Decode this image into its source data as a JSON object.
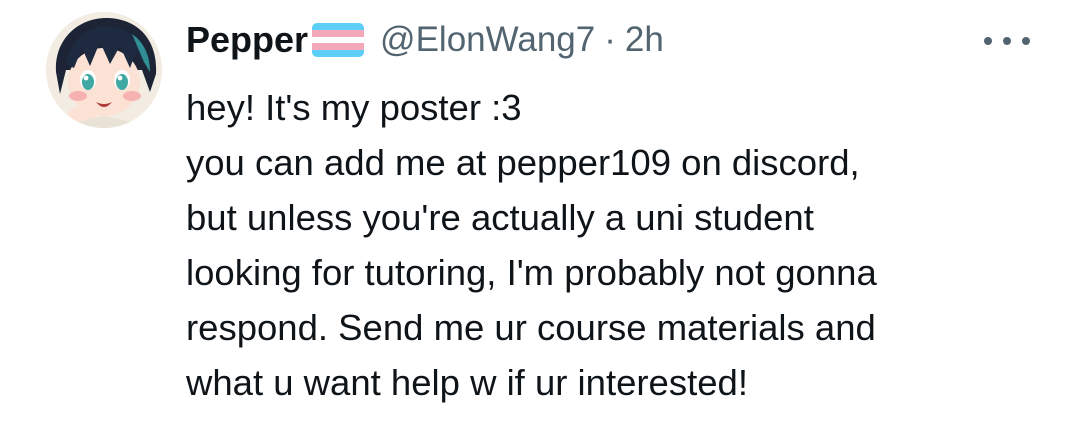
{
  "tweet": {
    "display_name": "Pepper",
    "handle": "@ElonWang7",
    "separator": "·",
    "timestamp": "2h",
    "flag_icon": "transgender-flag-icon",
    "flag_colors": [
      "#5bcefa",
      "#f5a9b8",
      "#ffffff",
      "#f5a9b8",
      "#5bcefa"
    ],
    "more_icon": "more-options-icon",
    "avatar_icon": "user-avatar",
    "text_lines": [
      "hey! It's my poster :3",
      "you can add me at pepper109 on discord,",
      "but unless you're actually a uni student",
      "looking for tutoring, I'm probably not gonna",
      "respond. Send me ur course materials and",
      "what u want help w if ur interested!"
    ]
  }
}
